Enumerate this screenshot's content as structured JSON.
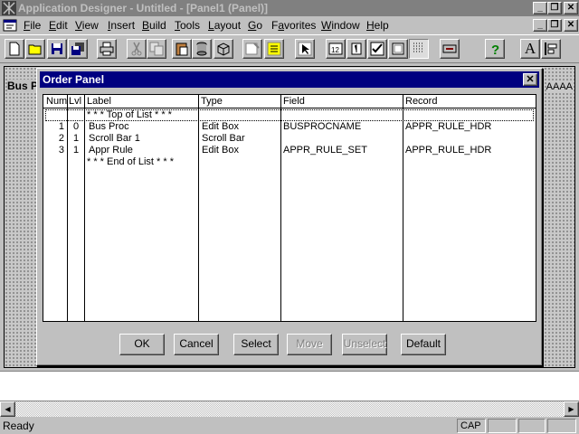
{
  "window": {
    "title": "Application Designer - Untitled - [Panel1 (Panel)]",
    "min_glyph": "_",
    "restore_glyph": "❐",
    "close_glyph": "✕"
  },
  "menu": [
    {
      "label": "File",
      "key": "F"
    },
    {
      "label": "Edit",
      "key": "E"
    },
    {
      "label": "View",
      "key": "V"
    },
    {
      "label": "Insert",
      "key": "I"
    },
    {
      "label": "Build",
      "key": "B"
    },
    {
      "label": "Tools",
      "key": "T"
    },
    {
      "label": "Layout",
      "key": "L"
    },
    {
      "label": "Go",
      "key": "G"
    },
    {
      "label": "Favorites",
      "key": "a"
    },
    {
      "label": "Window",
      "key": "W"
    },
    {
      "label": "Help",
      "key": "H"
    }
  ],
  "toolbar": {
    "font_button": "A"
  },
  "design": {
    "bus_label": "Bus P",
    "right_text": "AAAA"
  },
  "dialog": {
    "title": "Order Panel",
    "columns": [
      "Num",
      "Lvl",
      "Label",
      "Type",
      "Field",
      "Record"
    ],
    "top_marker": "* * * Top of List * * *",
    "end_marker": "* * * End of List * * *",
    "rows": [
      {
        "num": "1",
        "lvl": "0",
        "label": "Bus Proc",
        "type": "Edit Box",
        "field": "BUSPROCNAME",
        "record": "APPR_RULE_HDR"
      },
      {
        "num": "2",
        "lvl": "1",
        "label": "Scroll Bar 1",
        "type": "Scroll Bar",
        "field": "",
        "record": ""
      },
      {
        "num": "3",
        "lvl": "1",
        "label": "Appr Rule",
        "type": "Edit Box",
        "field": "APPR_RULE_SET",
        "record": "APPR_RULE_HDR"
      }
    ],
    "buttons": {
      "ok": "OK",
      "cancel": "Cancel",
      "select": "Select",
      "move": "Move",
      "unselect": "Unselect",
      "default": "Default"
    }
  },
  "status": {
    "text": "Ready",
    "cap": "CAP"
  },
  "scroll": {
    "left_arrow": "◀",
    "right_arrow": "▶"
  }
}
